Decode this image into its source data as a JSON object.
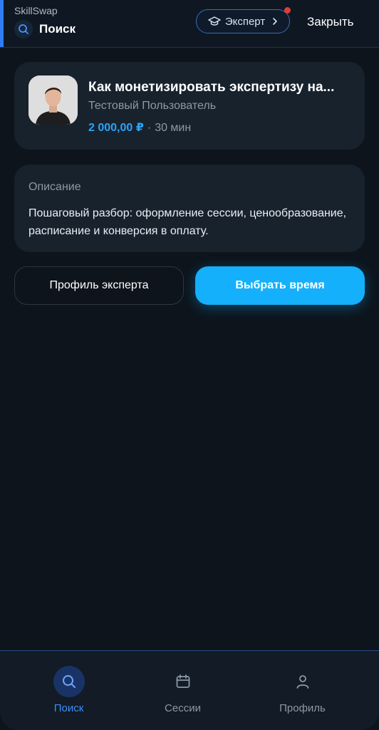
{
  "header": {
    "app_name": "SkillSwap",
    "title": "Поиск",
    "expert_label": "Эксперт",
    "close_label": "Закрыть"
  },
  "session": {
    "title": "Как монетизировать экспертизу на...",
    "author": "Тестовый Пользователь",
    "price": "2 000,00 ₽",
    "separator": "·",
    "duration": "30 мин"
  },
  "description": {
    "label": "Описание",
    "text": "Пошаговый разбор: оформление сессии, ценообразование, расписание и конверсия в оплату."
  },
  "actions": {
    "profile_label": "Профиль эксперта",
    "choose_time_label": "Выбрать время"
  },
  "tabbar": {
    "items": [
      {
        "label": "Поиск",
        "icon": "search-icon",
        "active": true
      },
      {
        "label": "Сессии",
        "icon": "calendar-icon",
        "active": false
      },
      {
        "label": "Профиль",
        "icon": "user-icon",
        "active": false
      }
    ]
  },
  "colors": {
    "background": "#0d141c",
    "card": "#18222d",
    "accent": "#15b0fb",
    "price": "#2aa3f7",
    "tab_active": "#3d8dfa",
    "notification": "#e53935"
  }
}
